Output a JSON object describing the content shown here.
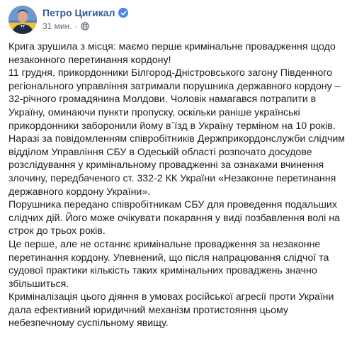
{
  "post": {
    "author": "Петро Цигикал",
    "time": "31 мин.",
    "separator": "·",
    "paragraphs": [
      "Крига зрушила з місця: маємо перше кримінальне провадження щодо незаконного перетинання кордону!",
      "11 грудня, прикордонники Білгород-Дністровського загону Південного регіонального управління затримали порушника державного кордону – 32-річного громадянина Молдови. Чоловік намагався потрапити в Україну, оминаючи пункти пропуску, оскільки раніше українські прикордонники заборонили йому в`їзд в Україну терміном на 10 років.",
      "Наразі за повідомленням співробітників Держприкордонслужби слідчим відділом Управління СБУ в Одеській області розпочато досудове розслідування у кримінальному провадженні за ознаками вчинення злочину, передбаченого ст. 332-2 КК України «Незаконне перетинання державного кордону України».",
      "Порушника передано співробітникам СБУ для проведення подальших слідчих дій. Його може очікувати покарання у виді позбавлення волі на строк до трьох років.",
      "Це перше, але не останнє кримінальне провадження за незаконне перетинання кордону. Упевнений, що після напрацювання слідчої та судової практики кількість таких кримінальних проваджень значно збільшиться.",
      "Криміналізація цього діяння в умовах російської агресії проти України дала ефективний юридичний механізм протистояння цьому небезпечному суспільному явищу."
    ]
  },
  "colors": {
    "author": "#385898",
    "text": "#1c1e21",
    "meta": "#616770",
    "verified": "#4a87e8"
  },
  "icons": {
    "verified": "verified-badge-icon",
    "audience": "globe-icon"
  }
}
